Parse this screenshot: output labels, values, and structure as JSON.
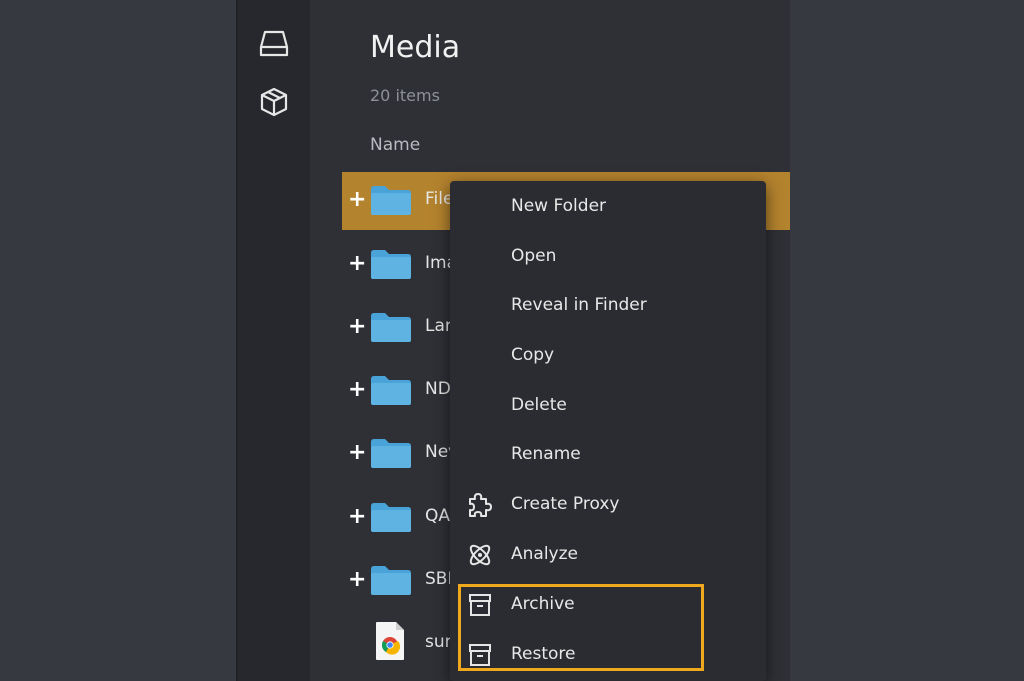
{
  "sidebar": {
    "icons": [
      "drive-icon",
      "package-icon"
    ]
  },
  "main": {
    "title": "Media",
    "item_count": "20 items",
    "column_header": "Name",
    "rows": [
      {
        "name": "File",
        "type": "folder",
        "expander": "+"
      },
      {
        "name": "Ima",
        "type": "folder",
        "expander": "+"
      },
      {
        "name": "Lar",
        "type": "folder",
        "expander": "+"
      },
      {
        "name": "ND",
        "type": "folder",
        "expander": "+"
      },
      {
        "name": "Nev",
        "type": "folder",
        "expander": "+"
      },
      {
        "name": "QA",
        "type": "folder",
        "expander": "+"
      },
      {
        "name": "SBI",
        "type": "folder",
        "expander": "+"
      },
      {
        "name": "sur",
        "type": "file",
        "expander": ""
      }
    ]
  },
  "context_menu": {
    "items": [
      {
        "label": "New Folder",
        "icon": ""
      },
      {
        "label": "Open",
        "icon": ""
      },
      {
        "label": "Reveal in Finder",
        "icon": ""
      },
      {
        "label": "Copy",
        "icon": ""
      },
      {
        "label": "Delete",
        "icon": ""
      },
      {
        "label": "Rename",
        "icon": ""
      },
      {
        "label": "Create Proxy",
        "icon": "puzzle-icon"
      },
      {
        "label": "Analyze",
        "icon": "atom-icon"
      },
      {
        "label": "Archive",
        "icon": "archive-box-icon"
      },
      {
        "label": "Restore",
        "icon": "archive-box-icon"
      }
    ]
  },
  "colors": {
    "selected_row": "#b4832e",
    "highlight_box": "#f0a81c",
    "folder": "#4aa3d8"
  }
}
